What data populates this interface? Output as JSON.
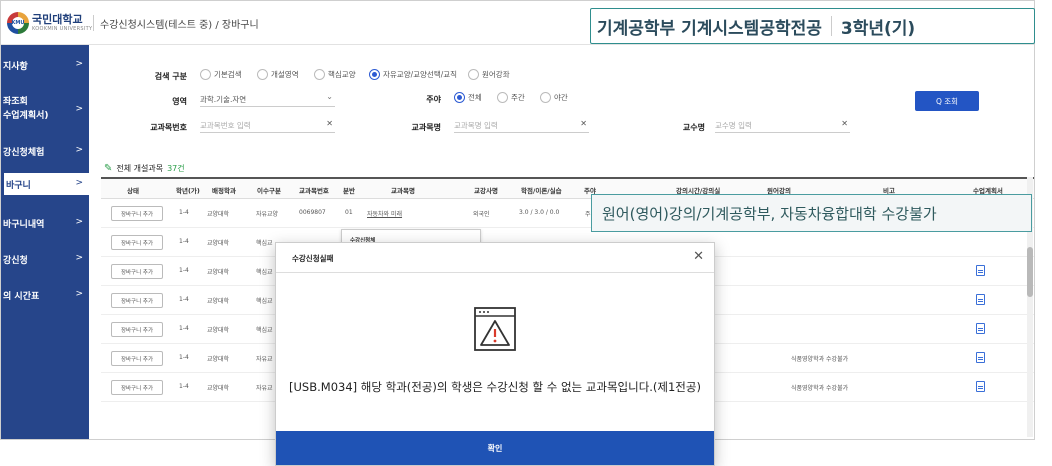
{
  "header": {
    "logo_text": "KMU",
    "university": "국민대학교",
    "university_en": "KOOKMIN UNIVERSITY",
    "breadcrumb": "수강신청시스템(테스트 중) / 장바구니"
  },
  "sidebar": {
    "items": [
      {
        "label": "지사항",
        "chevron": ">"
      },
      {
        "label": "좌조회\n수업계획서)",
        "chevron": ">"
      },
      {
        "label": "강신청체험",
        "chevron": ">"
      },
      {
        "label": "바구니",
        "chevron": ">"
      },
      {
        "label": "바구니내역",
        "chevron": ">"
      },
      {
        "label": "강신청",
        "chevron": ">"
      },
      {
        "label": "의 시간표",
        "chevron": ">"
      }
    ]
  },
  "filters": {
    "search_type_label": "검색 구분",
    "search_type_options": [
      "기본검색",
      "개설영역",
      "핵심교양",
      "자유교양/교양선택/교직",
      "원어강좌"
    ],
    "search_type_selected": "자유교양/교양선택/교직",
    "area_label": "영역",
    "area_value": "과학.기술.자연",
    "daynight_label": "주야",
    "daynight_options": [
      "전체",
      "주간",
      "야간"
    ],
    "daynight_selected": "전체",
    "course_no_label": "교과목번호",
    "course_no_placeholder": "교과목번호 입력",
    "course_name_label": "교과목명",
    "course_name_placeholder": "교과목명 입력",
    "professor_label": "교수명",
    "professor_placeholder": "교수명 입력",
    "search_button": "Q 조회"
  },
  "table": {
    "count_prefix": "전체 개설과목",
    "count_value": "37건",
    "columns": [
      "상태",
      "학년(가)",
      "배정학과",
      "이수구분",
      "교과목번호",
      "분반",
      "교과목명",
      "교강사명",
      "학점/이론/실습",
      "주야",
      "강의시간/강의실",
      "원어강의",
      "비고",
      "수업계획서"
    ],
    "rows": [
      {
        "action": "장바구니 추가",
        "grade": "1-4",
        "dept": "교양대학",
        "type": "자유교양",
        "course_no": "0069807",
        "section": "01",
        "name": "자동차와 미래",
        "prof": "외국인",
        "credit": "3.0 / 3.0 / 0.0",
        "dn": "주",
        "note": ""
      },
      {
        "action": "장바구니 추가",
        "grade": "1-4",
        "dept": "교양대학",
        "type": "핵심교",
        "note": ""
      },
      {
        "action": "장바구니 추가",
        "grade": "1-4",
        "dept": "교양대학",
        "type": "핵심교",
        "note": ""
      },
      {
        "action": "장바구니 추가",
        "grade": "1-4",
        "dept": "교양대학",
        "type": "핵심교",
        "note": ""
      },
      {
        "action": "장바구니 추가",
        "grade": "1-4",
        "dept": "교양대학",
        "type": "핵심교",
        "note": ""
      },
      {
        "action": "장바구니 추가",
        "grade": "1-4",
        "dept": "교양대학",
        "type": "자유교",
        "note": "식품영양학과 수강불가"
      },
      {
        "action": "장바구니 추가",
        "grade": "1-4",
        "dept": "교양대학",
        "type": "자유교",
        "note": "식품영양학과 수강불가"
      }
    ]
  },
  "subwindow": {
    "title": "수강신청체"
  },
  "modal": {
    "title": "수강신청실패",
    "close": "✕",
    "message": "[USB.M034] 해당 학과(전공)의 학생은 수강신청 할 수 없는 교과목입니다.(제1전공)",
    "ok_button": "확인"
  },
  "callouts": {
    "student_major": "기계공학부 기계시스템공학전공",
    "student_year": "3학년(기)",
    "restriction": "원어(영어)강의/기계공학부, 자동차융합대학 수강불가"
  }
}
